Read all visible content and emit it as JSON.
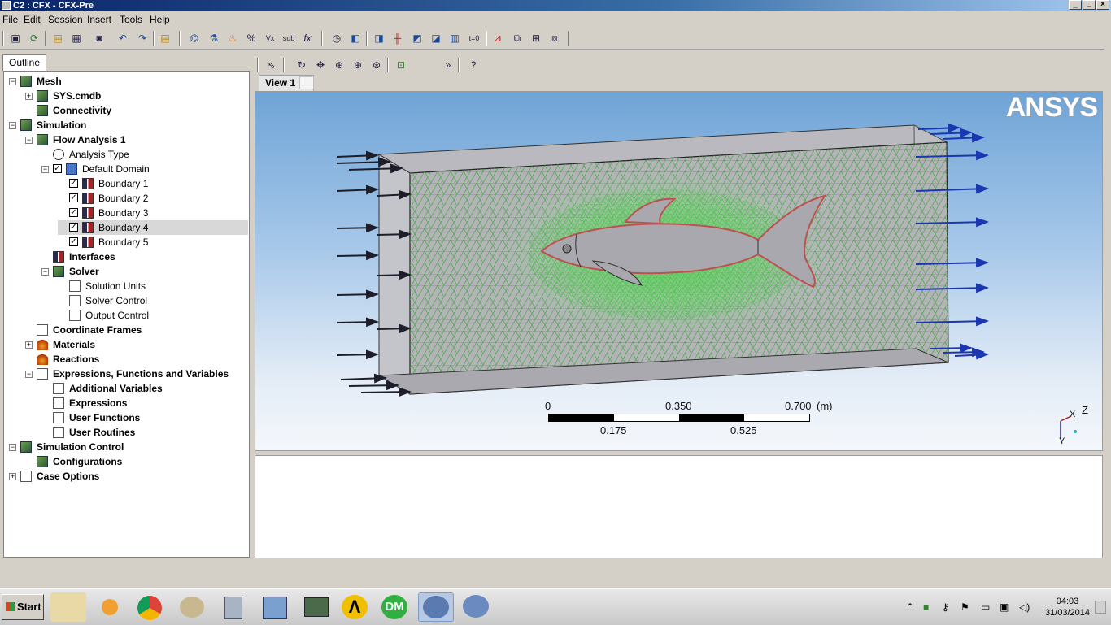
{
  "window": {
    "title": "C2 : CFX - CFX-Pre"
  },
  "menu": [
    "File",
    "Edit",
    "Session",
    "Insert",
    "Tools",
    "Help"
  ],
  "outline_tab": "Outline",
  "tree": [
    {
      "label": "Mesh",
      "bold": true,
      "level": 0,
      "exp": "-",
      "icon": "mesh-icon",
      "ic": "green"
    },
    {
      "label": "SYS.cmdb",
      "bold": true,
      "level": 1,
      "exp": "+",
      "icon": "mesh-file-icon",
      "ic": "green"
    },
    {
      "label": "Connectivity",
      "bold": true,
      "level": 1,
      "exp": "",
      "icon": "connectivity-icon",
      "ic": "green"
    },
    {
      "label": "Simulation",
      "bold": true,
      "level": 0,
      "exp": "-",
      "icon": "simulation-icon",
      "ic": "green"
    },
    {
      "label": "Flow Analysis 1",
      "bold": true,
      "level": 1,
      "exp": "-",
      "icon": "flow-analysis-icon",
      "ic": "green"
    },
    {
      "label": "Analysis Type",
      "bold": false,
      "level": 2,
      "exp": "",
      "icon": "clock-icon",
      "ic": "clock"
    },
    {
      "label": "Default Domain",
      "bold": false,
      "level": 2,
      "exp": "-",
      "icon": "domain-icon",
      "ic": "blue",
      "check": true
    },
    {
      "label": "Boundary 1",
      "bold": false,
      "level": 3,
      "exp": "",
      "icon": "boundary-icon",
      "ic": "bnd",
      "check": true
    },
    {
      "label": "Boundary 2",
      "bold": false,
      "level": 3,
      "exp": "",
      "icon": "boundary-icon",
      "ic": "bnd",
      "check": true
    },
    {
      "label": "Boundary 3",
      "bold": false,
      "level": 3,
      "exp": "",
      "icon": "boundary-icon",
      "ic": "bnd",
      "check": true
    },
    {
      "label": "Boundary 4",
      "bold": false,
      "level": 3,
      "exp": "",
      "icon": "boundary-icon",
      "ic": "bnd",
      "check": true,
      "selected": true
    },
    {
      "label": "Boundary 5",
      "bold": false,
      "level": 3,
      "exp": "",
      "icon": "boundary-icon",
      "ic": "bnd",
      "check": true
    },
    {
      "label": "Interfaces",
      "bold": true,
      "level": 2,
      "exp": "",
      "icon": "interfaces-icon",
      "ic": "bnd"
    },
    {
      "label": "Solver",
      "bold": true,
      "level": 2,
      "exp": "-",
      "icon": "solver-icon",
      "ic": "green"
    },
    {
      "label": "Solution Units",
      "bold": false,
      "level": 3,
      "exp": "",
      "icon": "units-icon",
      "ic": "f"
    },
    {
      "label": "Solver Control",
      "bold": false,
      "level": 3,
      "exp": "",
      "icon": "solver-control-icon",
      "ic": "f"
    },
    {
      "label": "Output Control",
      "bold": false,
      "level": 3,
      "exp": "",
      "icon": "output-control-icon",
      "ic": "f"
    },
    {
      "label": "Coordinate Frames",
      "bold": true,
      "level": 1,
      "exp": "",
      "icon": "coordinate-frame-icon",
      "ic": "f"
    },
    {
      "label": "Materials",
      "bold": true,
      "level": 1,
      "exp": "+",
      "icon": "materials-icon",
      "ic": "fire"
    },
    {
      "label": "Reactions",
      "bold": true,
      "level": 1,
      "exp": "",
      "icon": "reactions-icon",
      "ic": "fire"
    },
    {
      "label": "Expressions, Functions and Variables",
      "bold": true,
      "level": 1,
      "exp": "-",
      "icon": "expressions-icon",
      "ic": "f"
    },
    {
      "label": "Additional Variables",
      "bold": true,
      "level": 2,
      "exp": "",
      "icon": "variables-icon",
      "ic": "f"
    },
    {
      "label": "Expressions",
      "bold": true,
      "level": 2,
      "exp": "",
      "icon": "expression-icon",
      "ic": "f"
    },
    {
      "label": "User Functions",
      "bold": true,
      "level": 2,
      "exp": "",
      "icon": "function-icon",
      "ic": "f"
    },
    {
      "label": "User Routines",
      "bold": true,
      "level": 2,
      "exp": "",
      "icon": "routine-icon",
      "ic": "f"
    },
    {
      "label": "Simulation Control",
      "bold": true,
      "level": 0,
      "exp": "-",
      "icon": "simulation-control-icon",
      "ic": "green"
    },
    {
      "label": "Configurations",
      "bold": true,
      "level": 1,
      "exp": "",
      "icon": "configurations-icon",
      "ic": "green"
    },
    {
      "label": "Case Options",
      "bold": true,
      "level": 0,
      "exp": "+",
      "icon": "case-options-icon",
      "ic": "f"
    }
  ],
  "viewer": {
    "tab": "View 1",
    "logo": "ANSYS",
    "scale": {
      "top": [
        "0",
        "0.350",
        "0.700"
      ],
      "bottom": [
        "0.175",
        "0.525"
      ],
      "unit": "(m)"
    },
    "axes": {
      "z": "Z",
      "x": "X",
      "y": "Y"
    }
  },
  "taskbar": {
    "start": "Start",
    "time": "04:03",
    "date": "31/03/2014"
  },
  "icons": {
    "toolbar": [
      "save-icon",
      "refresh-icon",
      "open-icon",
      "import-icon",
      "camera-icon",
      "undo-icon",
      "redo-icon",
      "folder-icon",
      "mesh-tool-icon",
      "flask-icon",
      "fire-icon",
      "expression-icon",
      "cel-icon",
      "subroutine-icon",
      "function-icon",
      "clock-icon",
      "edit-icon",
      "domain-icon",
      "boundary-icon",
      "subdomain-icon",
      "interface-icon",
      "initial-icon",
      "time-icon",
      "mesh-adapt-icon",
      "monitor-icon",
      "solver-icon"
    ],
    "viewer_toolbar": [
      "select-icon",
      "rotate-icon",
      "pan-icon",
      "zoom-icon",
      "zoom-box-icon",
      "zoom-fit-icon",
      "snap-icon",
      "more-icon",
      "help-icon"
    ]
  }
}
